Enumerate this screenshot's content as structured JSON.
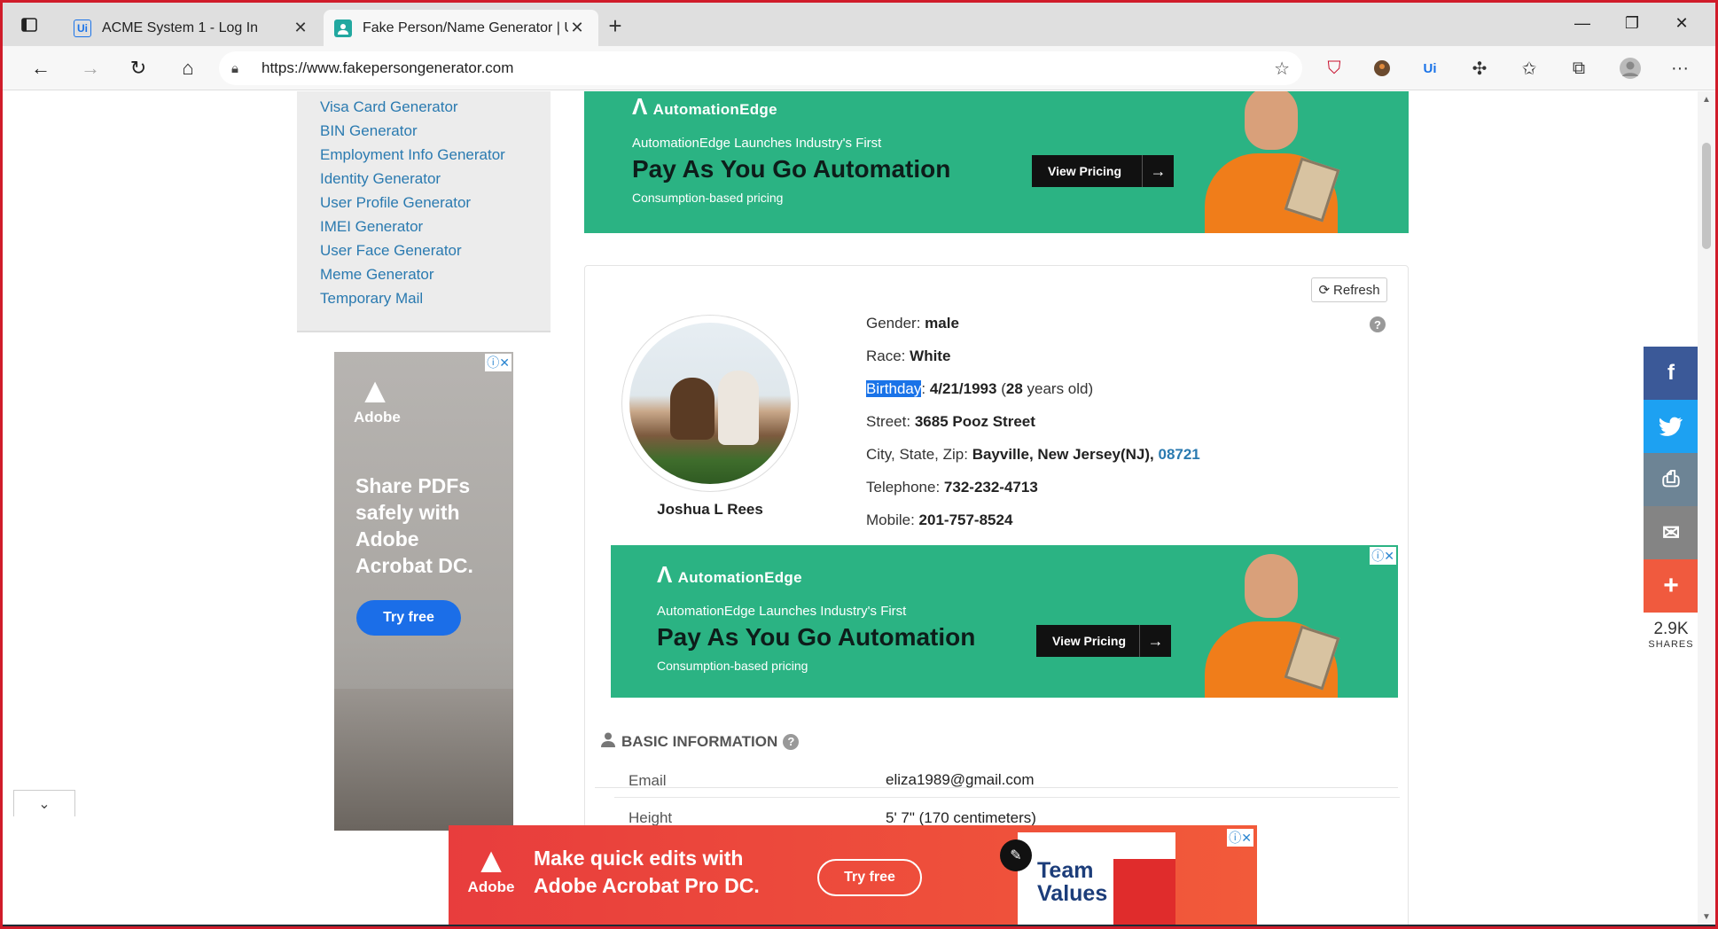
{
  "browser": {
    "tabs": [
      {
        "label": "ACME System 1 - Log In",
        "favicon": "Ui"
      },
      {
        "label": "Fake Person/Name Generator | U",
        "favicon": "person"
      }
    ],
    "url": "https://www.fakepersongenerator.com"
  },
  "sidebar": {
    "links": [
      "Visa Card Generator",
      "BIN Generator",
      "Employment Info Generator",
      "Identity Generator",
      "User Profile Generator",
      "IMEI Generator",
      "User Face Generator",
      "Meme Generator",
      "Temporary Mail"
    ]
  },
  "left_ad": {
    "brand": "Adobe",
    "headline": "Share PDFs safely with Adobe Acrobat DC.",
    "cta": "Try free"
  },
  "banner": {
    "brand": "AutomationEdge",
    "subtitle": "AutomationEdge Launches Industry's First",
    "headline": "Pay As You Go Automation",
    "tagline": "Consumption-based pricing",
    "cta": "View Pricing"
  },
  "person": {
    "refresh_label": "Refresh",
    "name": "Joshua L Rees",
    "gender_label": "Gender:",
    "gender": "male",
    "race_label": "Race:",
    "race": "White",
    "birthday_label": "Birthday",
    "birthday": "4/21/1993",
    "age_open": " (",
    "age": "28",
    "age_close": " years old)",
    "street_label": "Street:",
    "street": "3685 Pooz Street",
    "city_label": "City, State, Zip:",
    "city": "Bayville, New Jersey(NJ),",
    "zip": "08721",
    "telephone_label": "Telephone:",
    "telephone": "732-232-4713",
    "mobile_label": "Mobile:",
    "mobile": "201-757-8524"
  },
  "basic_info": {
    "title": "BASIC INFORMATION",
    "rows": [
      {
        "label": "Email",
        "value": "eliza1989@gmail.com"
      },
      {
        "label": "Height",
        "value": "5' 7\" (170 centimeters)"
      }
    ]
  },
  "share": {
    "count": "2.9K",
    "label": "SHARES"
  },
  "bottom_ad": {
    "brand": "Adobe",
    "message_line1": "Make quick edits with",
    "message_line2": "Adobe Acrobat Pro DC.",
    "cta": "Try free",
    "doc_title_line1": "Team",
    "doc_title_line2": "Values"
  },
  "colors": {
    "frame": "#d01c2a",
    "link": "#2a7ab0",
    "banner_green": "#2bb383",
    "facebook": "#3b5998",
    "twitter": "#1da1f2",
    "print": "#6d8495",
    "email": "#848484",
    "more": "#f05a3e"
  }
}
